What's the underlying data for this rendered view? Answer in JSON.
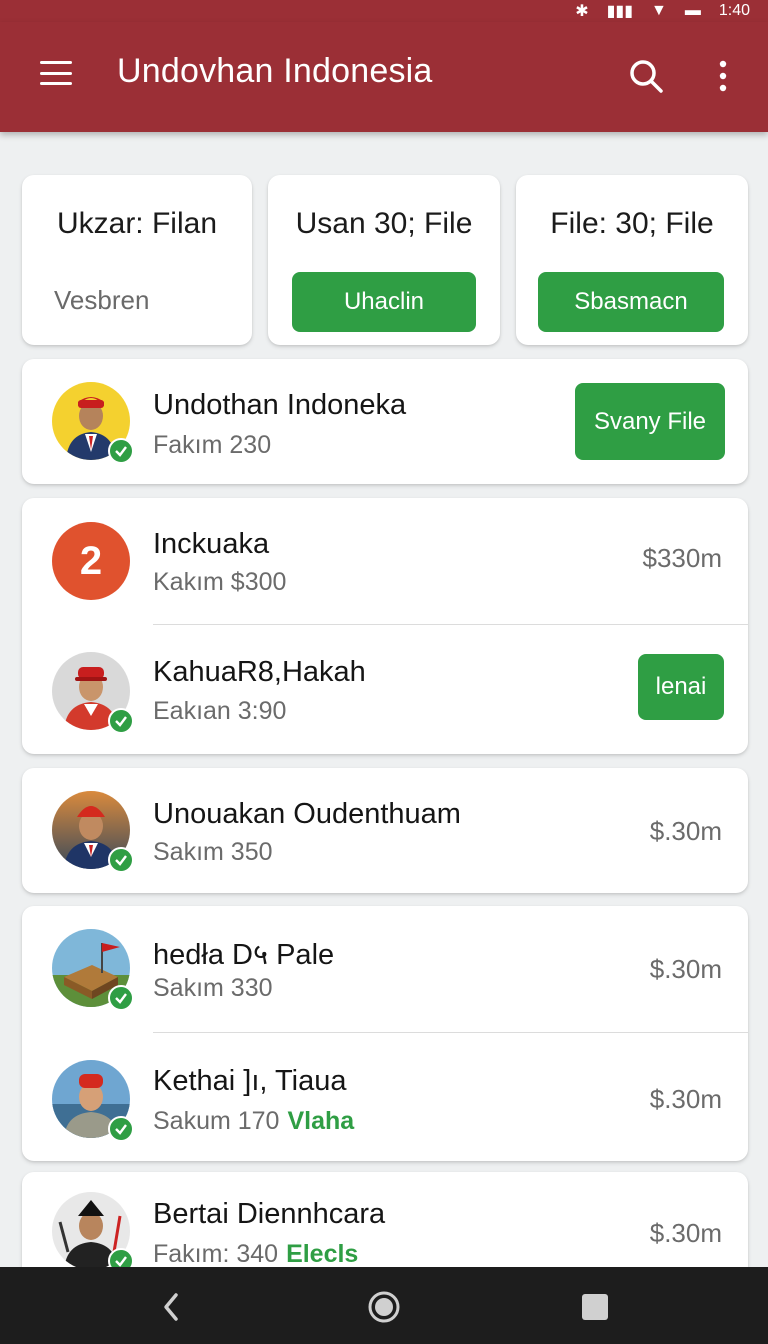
{
  "status_bar": {
    "time": "1:40"
  },
  "app_bar": {
    "title": "Undovhan Indonesia"
  },
  "filters": [
    {
      "title": "Ukzar: Filan",
      "subtitle": "Vesbren"
    },
    {
      "title": "Usan 30; File",
      "button": "Uhaclin"
    },
    {
      "title": "File: 30; File",
      "button": "Sbasmacn"
    }
  ],
  "featured": {
    "name": "Undothan Indoneka",
    "sub": "Fakım 230",
    "button": "Svany File"
  },
  "list_group_1": [
    {
      "name": "Inckuaka",
      "sub": "Kakım $300",
      "amount": "$330m",
      "badge": "2"
    },
    {
      "name": "KahuaR8,Hakah",
      "sub": "Eakıan 3:90",
      "button": "lenai"
    }
  ],
  "list_group_2": [
    {
      "name": "Unouakan Oudenthuam",
      "sub": "Sakım 350",
      "amount": "$.30m"
    }
  ],
  "list_group_3": [
    {
      "name": "hedła D५ Pale",
      "sub": "Sakım 330",
      "amount": "$.30m"
    },
    {
      "name": "Kethai ]ı, Tiaua",
      "sub": "Sakum 170",
      "tag": "Vlaha",
      "amount": "$.30m"
    }
  ],
  "list_group_4": [
    {
      "name": "Bertai Diennhcara",
      "sub": "Fakım: 340",
      "tag": "Elecls",
      "amount": "$.30m"
    }
  ],
  "colors": {
    "app_bar": "#9b2f36",
    "accent_green": "#2f9e44",
    "badge_orange": "#e0522e",
    "nav_bar": "#1d1d1d"
  },
  "icons": [
    "menu-icon",
    "search-icon",
    "more-vert-icon",
    "check-icon",
    "back-icon",
    "home-icon",
    "recents-icon"
  ]
}
